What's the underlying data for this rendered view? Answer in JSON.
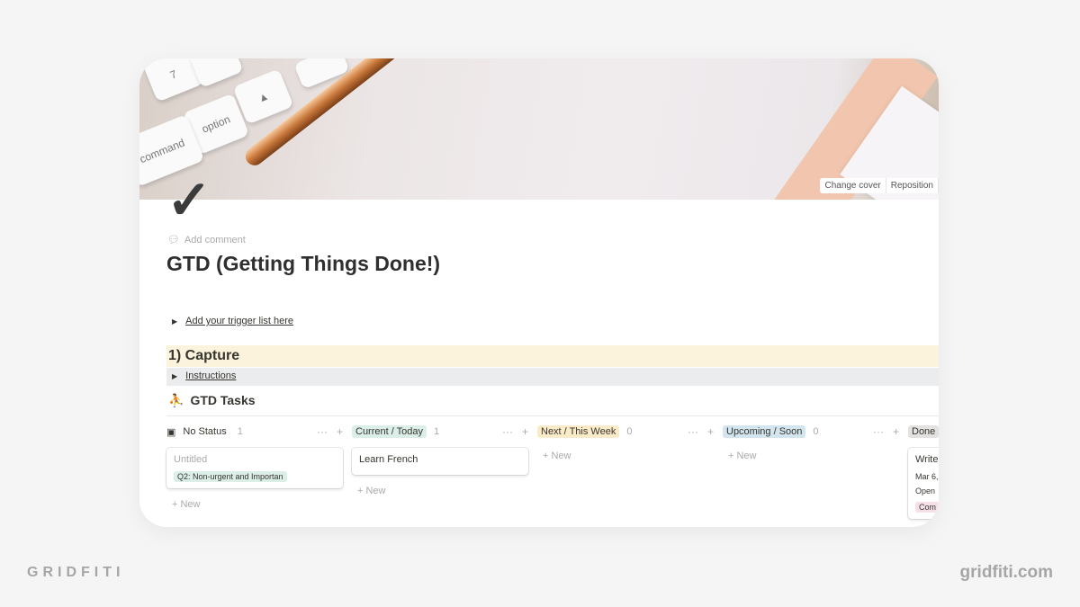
{
  "cover": {
    "change_cover": "Change cover",
    "reposition": "Reposition",
    "keys": [
      "7",
      "option",
      "command"
    ]
  },
  "page": {
    "icon": "checkmark-icon",
    "add_comment": "Add comment",
    "title": "GTD (Getting Things Done!)"
  },
  "blocks": {
    "trigger_toggle": "Add your trigger list here",
    "heading": "1) Capture",
    "instructions": "Instructions",
    "database_title": "GTD Tasks",
    "database_icon": "⛹"
  },
  "board": {
    "new_label": "New",
    "columns": [
      {
        "label": "No Status",
        "count": "1",
        "color": "",
        "cards": [
          {
            "title": "Untitled",
            "tag": "Q2: Non-urgent and Importan",
            "tag_color": "#dbeee8"
          }
        ]
      },
      {
        "label": "Current / Today",
        "count": "1",
        "color": "#dbeee8",
        "cards": [
          {
            "title": "Learn French"
          }
        ]
      },
      {
        "label": "Next / This Week",
        "count": "0",
        "color": "#fbecc9",
        "cards": []
      },
      {
        "label": "Upcoming / Soon",
        "count": "0",
        "color": "#d3e5ef",
        "cards": []
      },
      {
        "label": "Done",
        "count": "",
        "color": "#e3e2e0",
        "cards": [
          {
            "title": "Write",
            "date": "Mar 6,",
            "status": "Open",
            "tag": "Com",
            "tag_color": "#f5e0e9"
          }
        ]
      }
    ]
  },
  "watermark": {
    "brand": "GRIDFITI",
    "site": "gridfiti.com"
  }
}
